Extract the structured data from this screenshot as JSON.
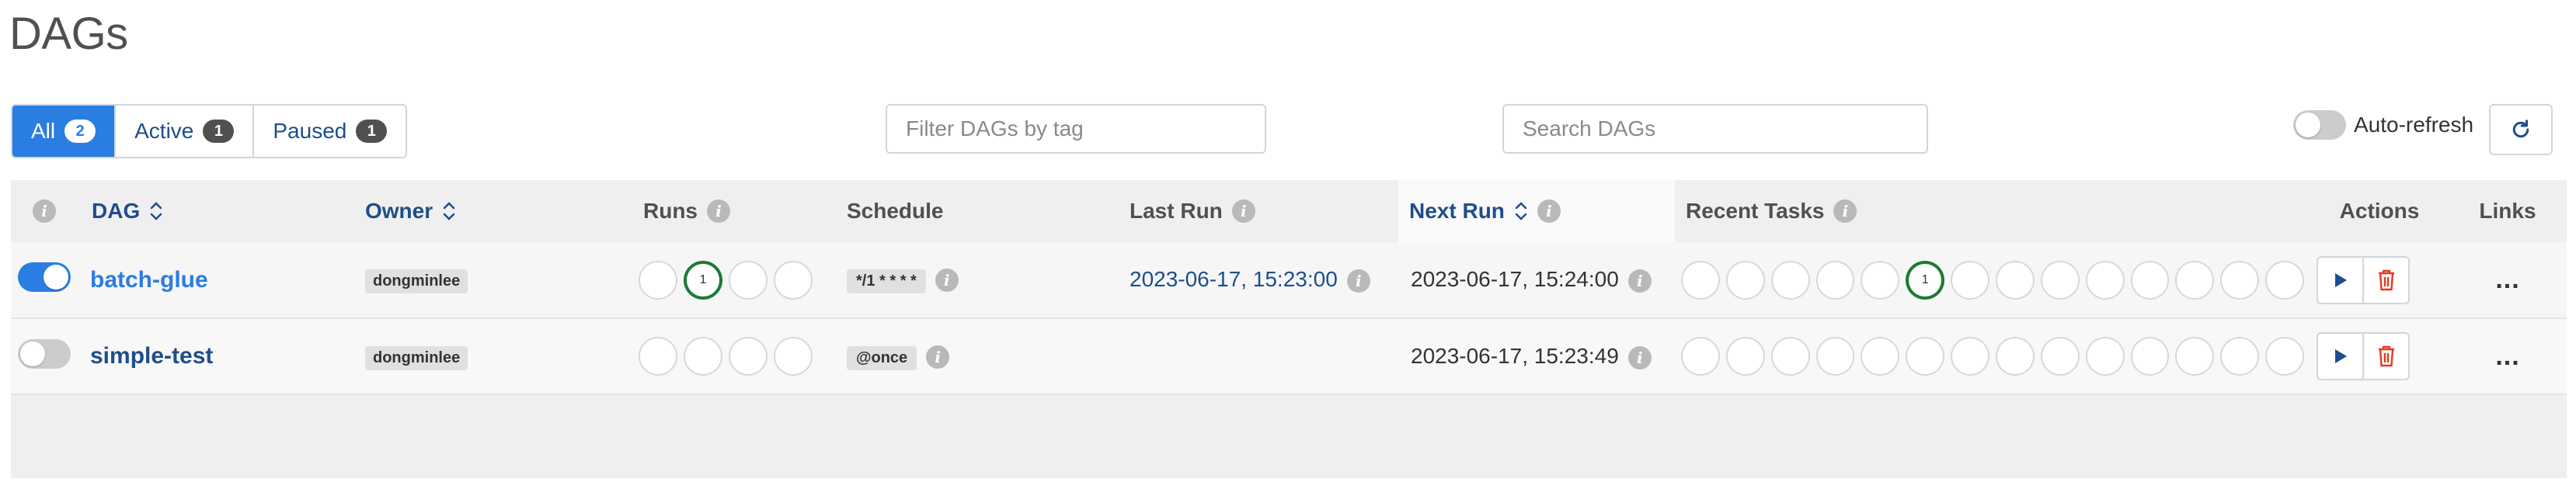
{
  "page": {
    "title": "DAGs"
  },
  "status_filter": {
    "all": {
      "label": "All",
      "count": "2"
    },
    "active": {
      "label": "Active",
      "count": "1"
    },
    "paused": {
      "label": "Paused",
      "count": "1"
    }
  },
  "tag_filter": {
    "placeholder": "Filter DAGs by tag",
    "value": ""
  },
  "search": {
    "placeholder": "Search DAGs",
    "value": ""
  },
  "auto_refresh": {
    "label": "Auto-refresh",
    "enabled": false
  },
  "table": {
    "headers": {
      "dag": "DAG",
      "owner": "Owner",
      "runs": "Runs",
      "schedule": "Schedule",
      "last_run": "Last Run",
      "next_run": "Next Run",
      "recent_tasks": "Recent Tasks",
      "actions": "Actions",
      "links": "Links"
    },
    "rows": [
      {
        "active": true,
        "dag_id": "batch-glue",
        "owner": "dongminlee",
        "runs": [
          "",
          "1",
          "",
          ""
        ],
        "schedule": "*/1 * * * *",
        "last_run": "2023-06-17, 15:23:00",
        "next_run": "2023-06-17, 15:24:00",
        "recent_tasks": [
          "",
          "",
          "",
          "",
          "",
          "1",
          "",
          "",
          "",
          "",
          "",
          "",
          "",
          ""
        ],
        "links": "..."
      },
      {
        "active": false,
        "dag_id": "simple-test",
        "owner": "dongminlee",
        "runs": [
          "",
          "",
          "",
          ""
        ],
        "schedule": "@once",
        "last_run": "",
        "next_run": "2023-06-17, 15:23:49",
        "recent_tasks": [
          "",
          "",
          "",
          "",
          "",
          "",
          "",
          "",
          "",
          "",
          "",
          "",
          "",
          ""
        ],
        "links": "..."
      }
    ]
  },
  "colors": {
    "accent": "#2a7de1",
    "link_dark": "#1f4d8c",
    "success": "#1d7a33",
    "delete": "#e43921",
    "badge": "#51504f"
  }
}
